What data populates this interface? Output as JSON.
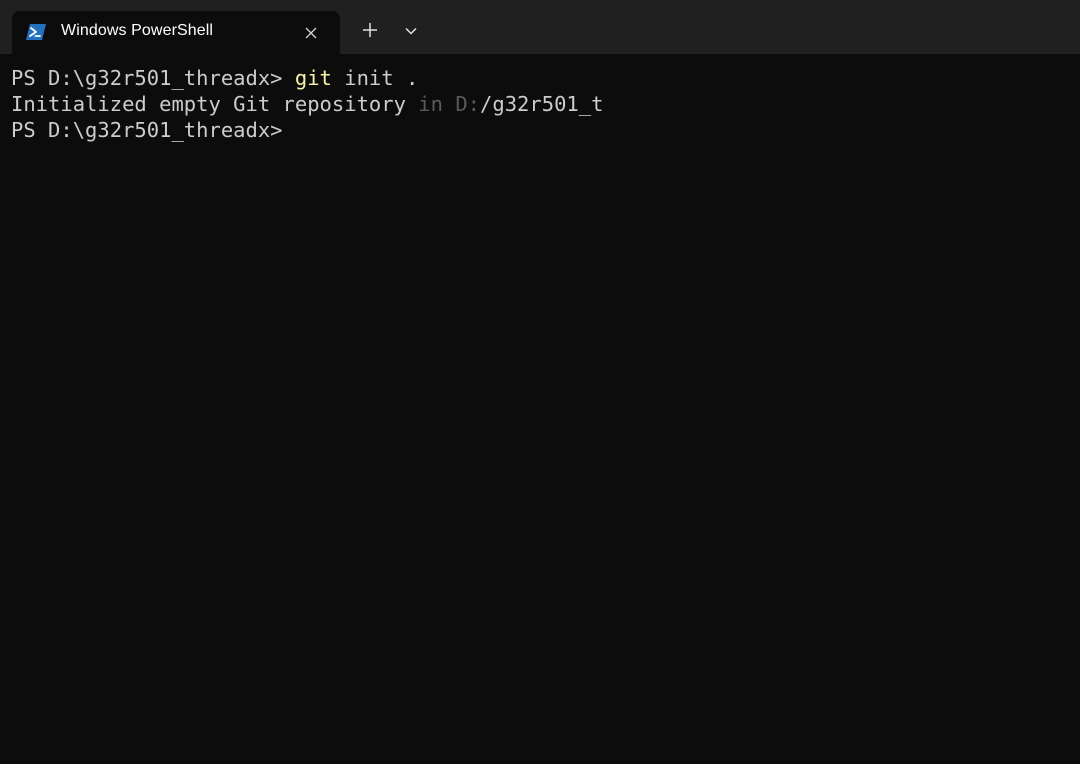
{
  "window": {
    "tab": {
      "title": "Windows PowerShell",
      "icon": "powershell-icon",
      "close_icon": "close-icon"
    },
    "new_tab_icon": "plus-icon",
    "dropdown_icon": "chevron-down-icon"
  },
  "terminal": {
    "line1": {
      "prompt": "PS D:\\g32r501_threadx> ",
      "command": "git",
      "args": " init ."
    },
    "line2": {
      "text_start": "Initialized empty Git repository ",
      "text_obscured": "in D:",
      "text_end": "/g32r501_t"
    },
    "line3": {
      "prompt": "PS D:\\g32r501_threadx>"
    }
  },
  "colors": {
    "tabbar_bg": "#202020",
    "terminal_bg": "#0c0c0c",
    "text": "#cccccc",
    "command": "#f9f1a5",
    "powershell_blue": "#2671be"
  }
}
